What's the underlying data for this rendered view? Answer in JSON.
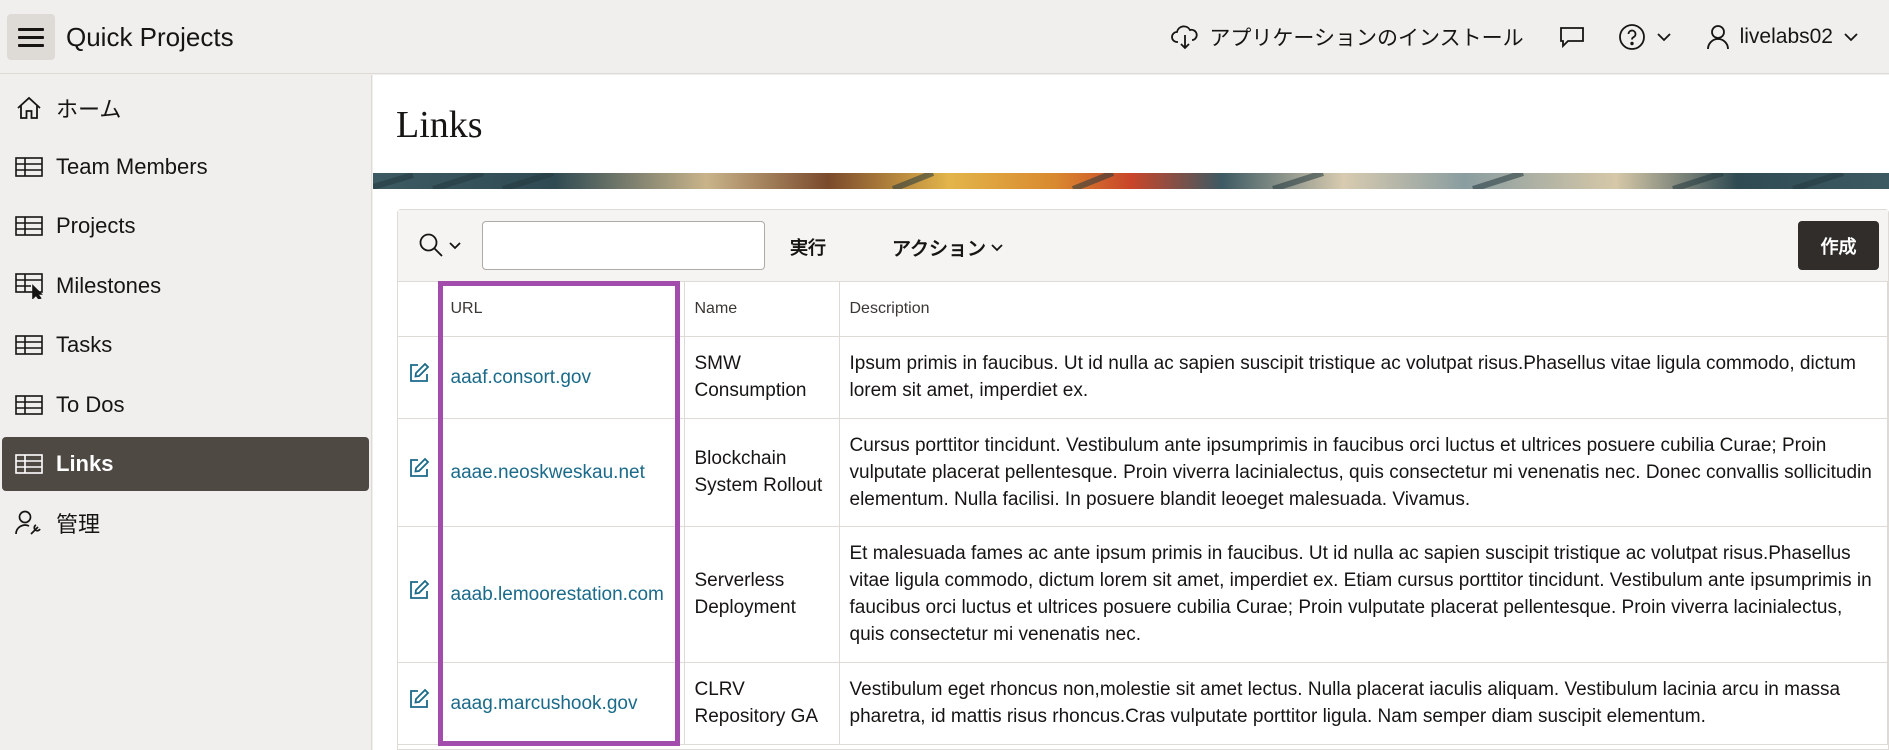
{
  "app": {
    "title": "Quick Projects"
  },
  "header": {
    "install_label": "アプリケーションのインストール",
    "username": "livelabs02"
  },
  "sidebar": {
    "items": [
      {
        "label": "ホーム",
        "icon": "home-icon",
        "active": false
      },
      {
        "label": "Team Members",
        "icon": "table-icon",
        "active": false
      },
      {
        "label": "Projects",
        "icon": "table-icon",
        "active": false
      },
      {
        "label": "Milestones",
        "icon": "table-pointer-icon",
        "active": false
      },
      {
        "label": "Tasks",
        "icon": "table-icon",
        "active": false
      },
      {
        "label": "To Dos",
        "icon": "table-icon",
        "active": false
      },
      {
        "label": "Links",
        "icon": "table-icon",
        "active": true
      },
      {
        "label": "管理",
        "icon": "user-wrench-icon",
        "active": false
      }
    ]
  },
  "page": {
    "title": "Links"
  },
  "toolbar": {
    "search_value": "",
    "run_label": "実行",
    "actions_label": "アクション",
    "create_label": "作成"
  },
  "table": {
    "headers": {
      "url": "URL",
      "name": "Name",
      "description": "Description"
    },
    "rows": [
      {
        "url": "aaaf.consort.gov",
        "name": "SMW Consumption",
        "description": "Ipsum primis in faucibus. Ut id nulla ac sapien suscipit tristique ac volutpat risus.Phasellus vitae ligula commodo, dictum lorem sit amet, imperdiet ex."
      },
      {
        "url": "aaae.neoskweskau.net",
        "name": "Blockchain System Rollout",
        "description": "Cursus porttitor tincidunt. Vestibulum ante ipsumprimis in faucibus orci luctus et ultrices posuere cubilia Curae; Proin vulputate placerat pellentesque. Proin viverra lacinialectus, quis consectetur mi venenatis nec. Donec convallis sollicitudin elementum. Nulla facilisi. In posuere blandit leoeget malesuada. Vivamus."
      },
      {
        "url": "aaab.lemoorestation.com",
        "name": "Serverless Deployment",
        "description": "Et malesuada fames ac ante ipsum primis in faucibus. Ut id nulla ac sapien suscipit tristique ac volutpat risus.Phasellus vitae ligula commodo, dictum lorem sit amet, imperdiet ex. Etiam cursus porttitor tincidunt. Vestibulum ante ipsumprimis in faucibus orci luctus et ultrices posuere cubilia Curae; Proin vulputate placerat pellentesque. Proin viverra lacinialectus, quis consectetur mi venenatis nec."
      },
      {
        "url": "aaag.marcushook.gov",
        "name": "CLRV Repository GA",
        "description": "Vestibulum eget rhoncus non,molestie sit amet lectus. Nulla placerat iaculis aliquam. Vestibulum lacinia arcu in massa pharetra, id mattis risus rhoncus.Cras vulputate porttitor ligula. Nam semper diam suscipit elementum."
      }
    ]
  },
  "colors": {
    "accent_dark": "#312d2a",
    "active_nav": "#4f4944",
    "link": "#1a6a8a",
    "highlight": "#a24cab"
  }
}
